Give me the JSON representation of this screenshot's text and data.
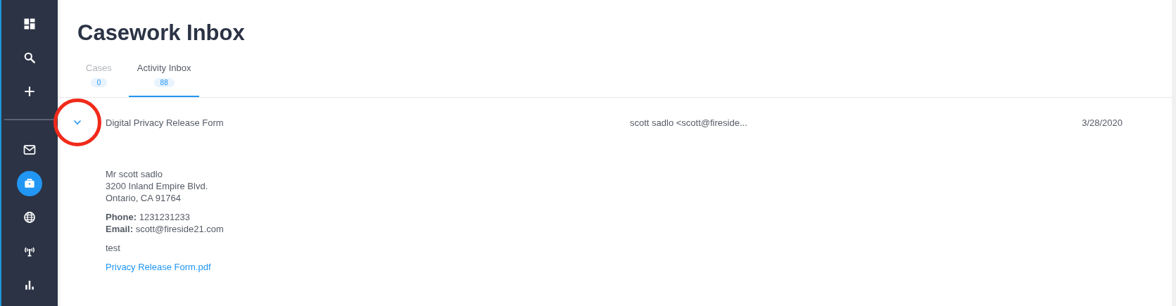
{
  "sidebar": {
    "top_items": [
      {
        "kind": "dashboard",
        "selected": false
      },
      {
        "kind": "search",
        "selected": false
      },
      {
        "kind": "add",
        "selected": false
      }
    ],
    "bottom_items": [
      {
        "kind": "mail",
        "selected": false
      },
      {
        "kind": "briefcase",
        "selected": true
      },
      {
        "kind": "globe",
        "selected": false
      },
      {
        "kind": "antenna",
        "selected": false
      },
      {
        "kind": "chart",
        "selected": false
      }
    ]
  },
  "page_title": "Casework Inbox",
  "tabs": [
    {
      "label": "Cases",
      "count": "0",
      "selected": false
    },
    {
      "label": "Activity Inbox",
      "count": "88",
      "selected": true
    }
  ],
  "messages": [
    {
      "subject": "Digital Privacy Release Form",
      "sender": "scott sadlo <scott@fireside...",
      "date": "3/28/2020",
      "expanded": true,
      "highlighted": true,
      "address_lines": [
        "Mr scott sadlo",
        "3200 Inland Empire Blvd.",
        "Ontario, CA 91764"
      ],
      "contact_lines": [
        "**Phone:** 1231231233",
        "**Email:** scott@fireside21.com"
      ],
      "note": "test",
      "attachment": "Privacy Release Form.pdf"
    }
  ]
}
